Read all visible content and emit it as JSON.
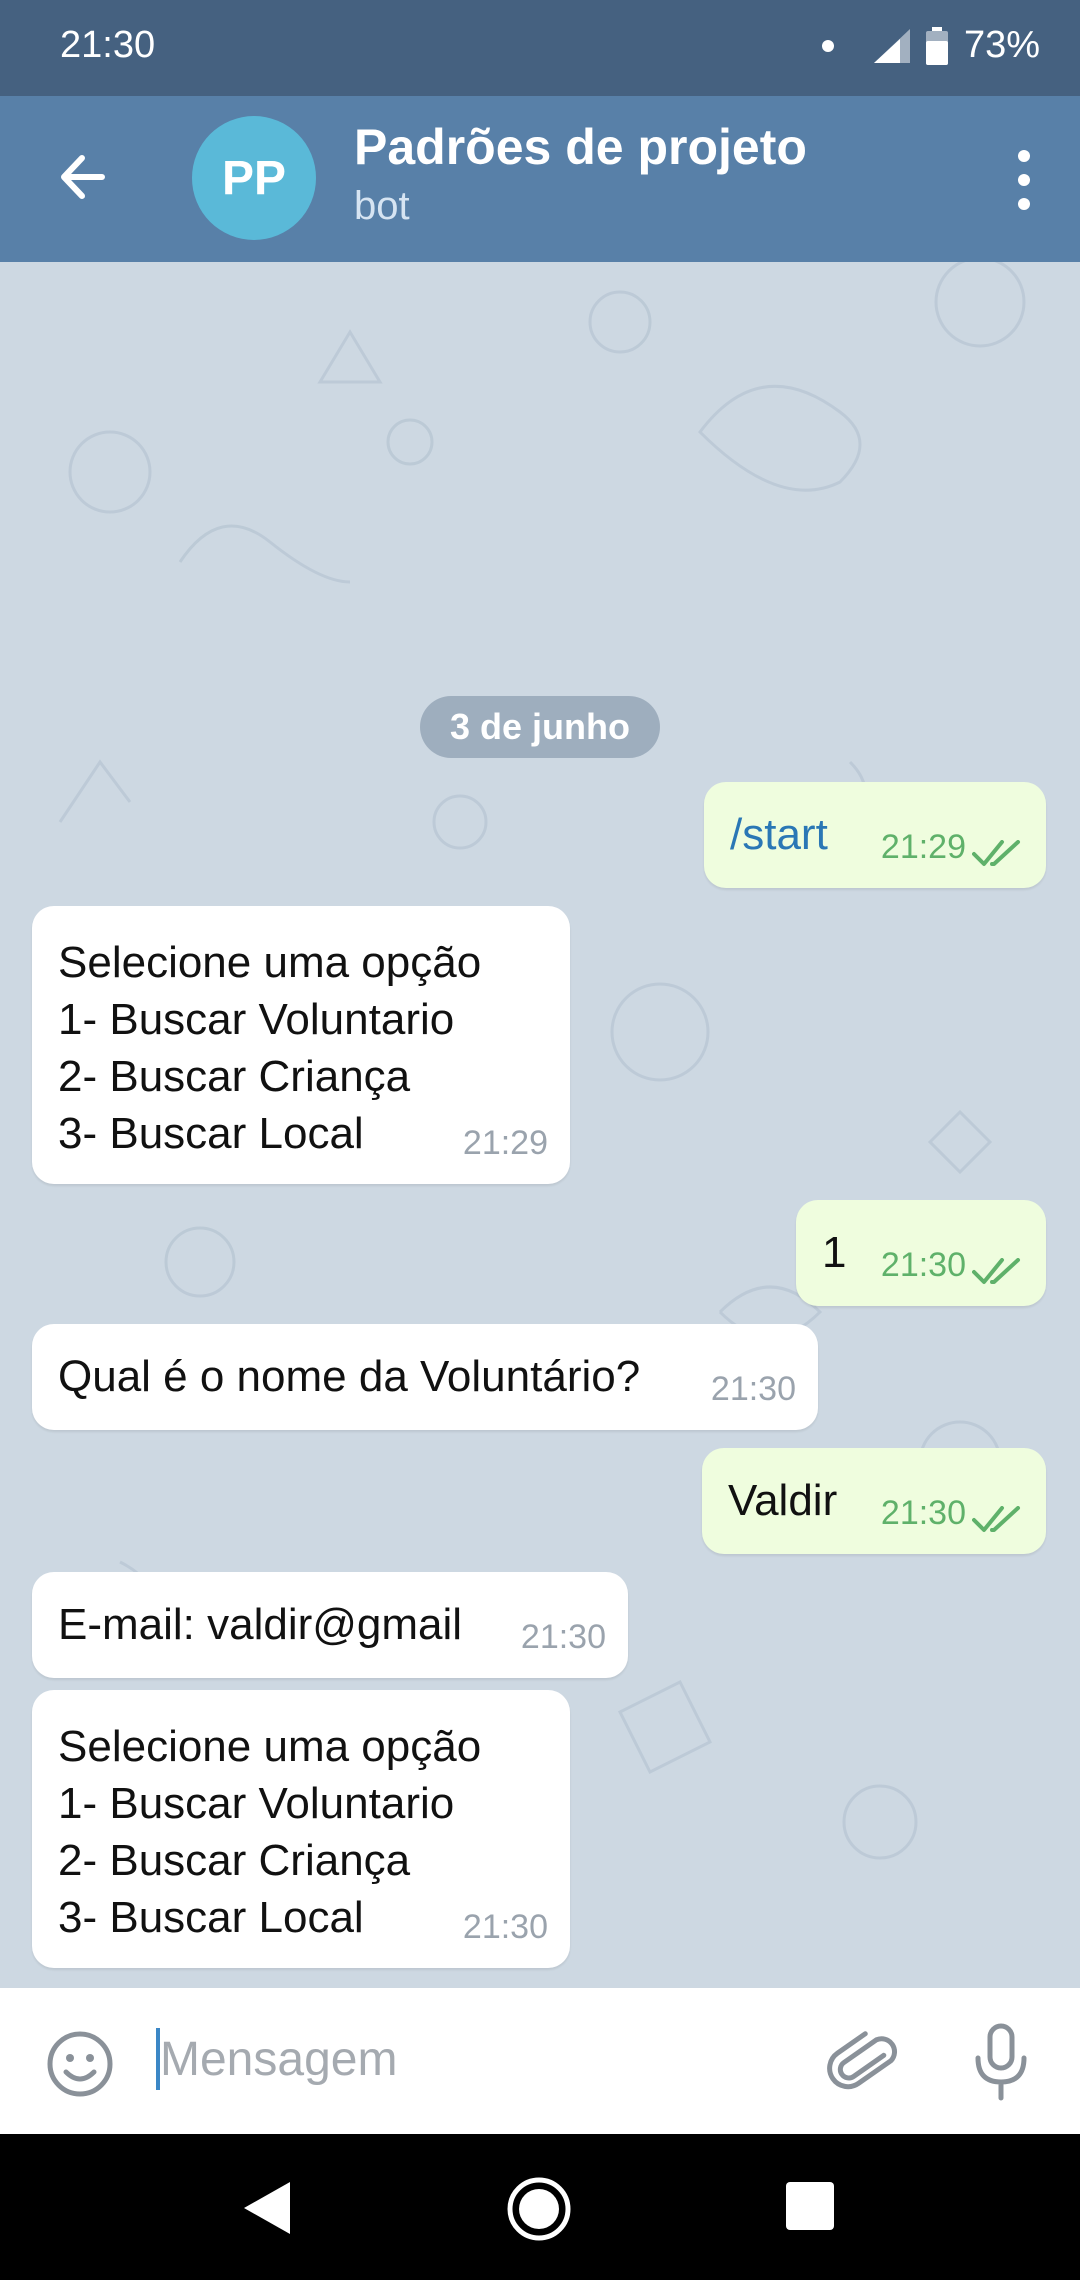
{
  "status": {
    "time": "21:30",
    "battery": "73%"
  },
  "header": {
    "avatar_initials": "PP",
    "title": "Padrões de projeto",
    "subtitle": "bot"
  },
  "chat": {
    "date": "3 de junho",
    "messages": [
      {
        "direction": "out",
        "text": "/start",
        "time": "21:29"
      },
      {
        "direction": "in",
        "text": "Selecione uma opção\n1- Buscar Voluntario\n2- Buscar Criança\n3- Buscar Local",
        "time": "21:29"
      },
      {
        "direction": "out",
        "text": "1",
        "time": "21:30"
      },
      {
        "direction": "in",
        "text": "Qual é o nome da Voluntário?",
        "time": "21:30"
      },
      {
        "direction": "out",
        "text": "Valdir",
        "time": "21:30"
      },
      {
        "direction": "in",
        "text": "E-mail: valdir@gmail",
        "time": "21:30"
      },
      {
        "direction": "in",
        "text": "Selecione uma opção\n1- Buscar Voluntario\n2- Buscar Criança\n3- Buscar Local",
        "time": "21:30"
      }
    ]
  },
  "input": {
    "placeholder": "Mensagem"
  },
  "colors": {
    "header": "#5880a8",
    "statusbar": "#456180",
    "outgoing": "#effdde",
    "incoming": "#ffffff",
    "chat_bg": "#cdd8e2"
  },
  "icons": [
    "back-arrow-icon",
    "more-vert-icon",
    "emoji-icon",
    "attach-icon",
    "mic-icon",
    "signal-icon",
    "battery-icon"
  ]
}
